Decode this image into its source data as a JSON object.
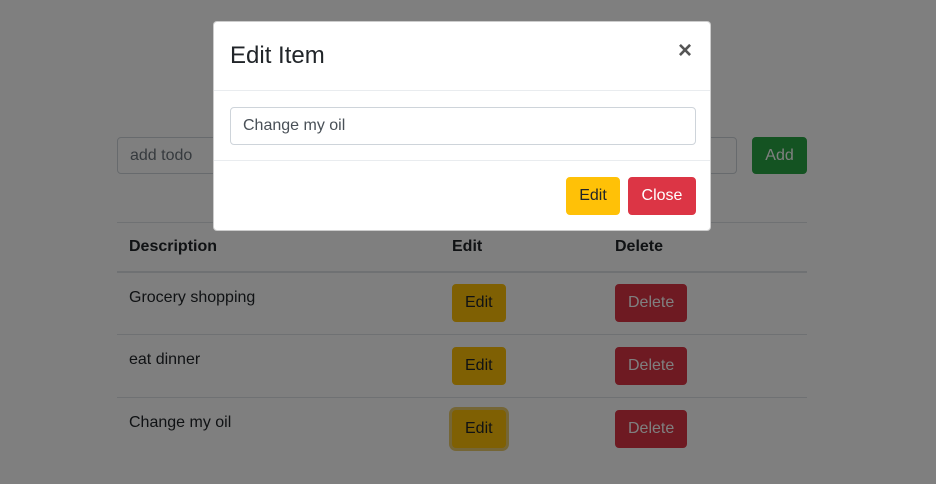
{
  "add_form": {
    "placeholder": "add todo",
    "add_label": "Add"
  },
  "table": {
    "headers": {
      "description": "Description",
      "edit": "Edit",
      "delete": "Delete"
    },
    "rows": [
      {
        "description": "Grocery shopping",
        "edit_label": "Edit",
        "delete_label": "Delete"
      },
      {
        "description": "eat dinner",
        "edit_label": "Edit",
        "delete_label": "Delete"
      },
      {
        "description": "Change my oil",
        "edit_label": "Edit",
        "delete_label": "Delete"
      }
    ]
  },
  "modal": {
    "title": "Edit Item",
    "close_icon": "close-icon",
    "close_glyph": "×",
    "input_value": "Change my oil",
    "edit_label": "Edit",
    "close_label": "Close"
  },
  "colors": {
    "success": "#28a745",
    "warning": "#ffc107",
    "danger": "#dc3545"
  }
}
